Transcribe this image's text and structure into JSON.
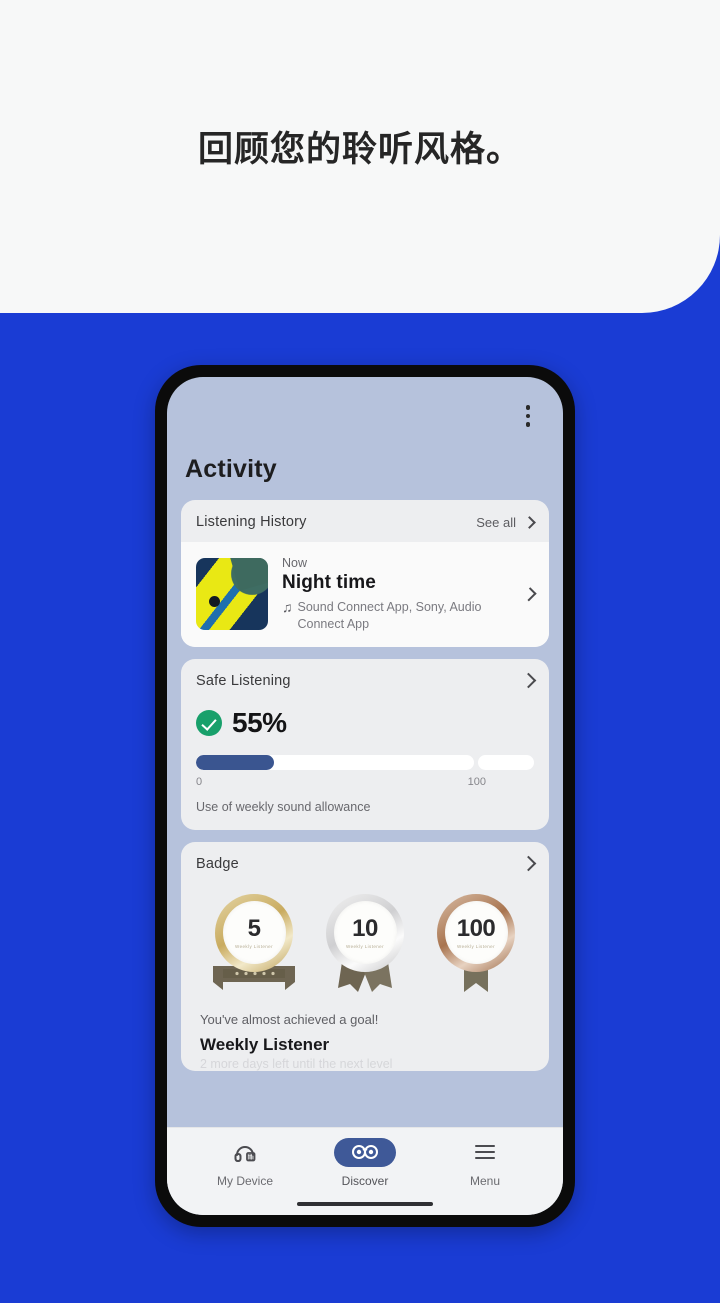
{
  "headline": "回顾您的聆听风格。",
  "theme": {
    "brand_blue": "#1a3cd4",
    "panel_white": "#f7f8f8",
    "screen_bg": "#b6c2dc",
    "card_bg": "#edeef0",
    "progress_fill": "#3a5590",
    "accent_green": "#18a06b",
    "nav_active": "#3f5998"
  },
  "app": {
    "page_title": "Activity",
    "overflow_menu_icon": "kebab-menu-icon"
  },
  "listening_history": {
    "title": "Listening History",
    "see_all_label": "See all",
    "chevron_icon": "chevron-right-icon",
    "item": {
      "time_label": "Now",
      "track_title": "Night time",
      "source_icon": "music-note-icon",
      "source_text": "Sound Connect App, Sony, Audio Connect App",
      "chevron_icon": "chevron-right-icon",
      "album_art": "abstract-yellow-blue-artwork"
    }
  },
  "safe_listening": {
    "title": "Safe Listening",
    "chevron_icon": "chevron-right-icon",
    "status_icon": "check-circle-icon",
    "percent_label": "55%",
    "percent_value": 55,
    "bar_fill_ratio": 28,
    "scale_min": "0",
    "scale_max": "100",
    "caption": "Use of weekly sound allowance"
  },
  "badge": {
    "title": "Badge",
    "chevron_icon": "chevron-right-icon",
    "medals": [
      {
        "number": "5",
        "tier": "gold",
        "sub": "Weekly Listener",
        "icon": "medal-gold-icon"
      },
      {
        "number": "10",
        "tier": "silver",
        "sub": "Weekly Listener",
        "icon": "medal-silver-icon"
      },
      {
        "number": "100",
        "tier": "bronze",
        "sub": "Weekly Listener",
        "icon": "medal-bronze-icon"
      }
    ],
    "note": "You've almost achieved a goal!",
    "level_name": "Weekly Listener",
    "level_sub": "2 more days left until the next level"
  },
  "bottom_nav": {
    "items": [
      {
        "label": "My Device",
        "icon": "headphones-icon",
        "active": false
      },
      {
        "label": "Discover",
        "icon": "binoculars-icon",
        "active": true
      },
      {
        "label": "Menu",
        "icon": "hamburger-menu-icon",
        "active": false
      }
    ]
  }
}
